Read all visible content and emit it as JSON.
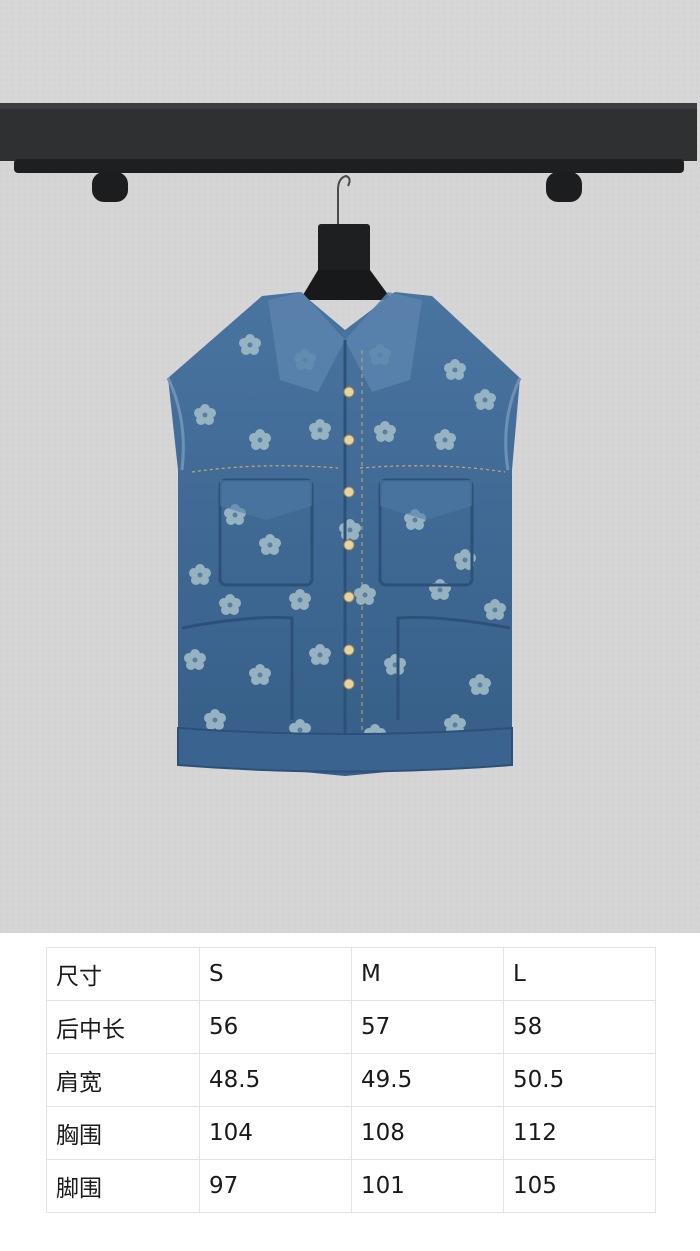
{
  "size_table": {
    "header": [
      "尺寸",
      "S",
      "M",
      "L"
    ],
    "rows": [
      [
        "后中长",
        "56",
        "57",
        "58"
      ],
      [
        "肩宽",
        "48.5",
        "49.5",
        "50.5"
      ],
      [
        "胸围",
        "104",
        "108",
        "112"
      ],
      [
        "脚围",
        "97",
        "101",
        "105"
      ]
    ]
  },
  "colors": {
    "wall": "#d6d6d6",
    "rack": "#2f3032",
    "denim": "#3d6791",
    "flower": "#9bb7c4"
  },
  "icons": [
    "clothing-rack",
    "hanger",
    "denim-vest"
  ]
}
